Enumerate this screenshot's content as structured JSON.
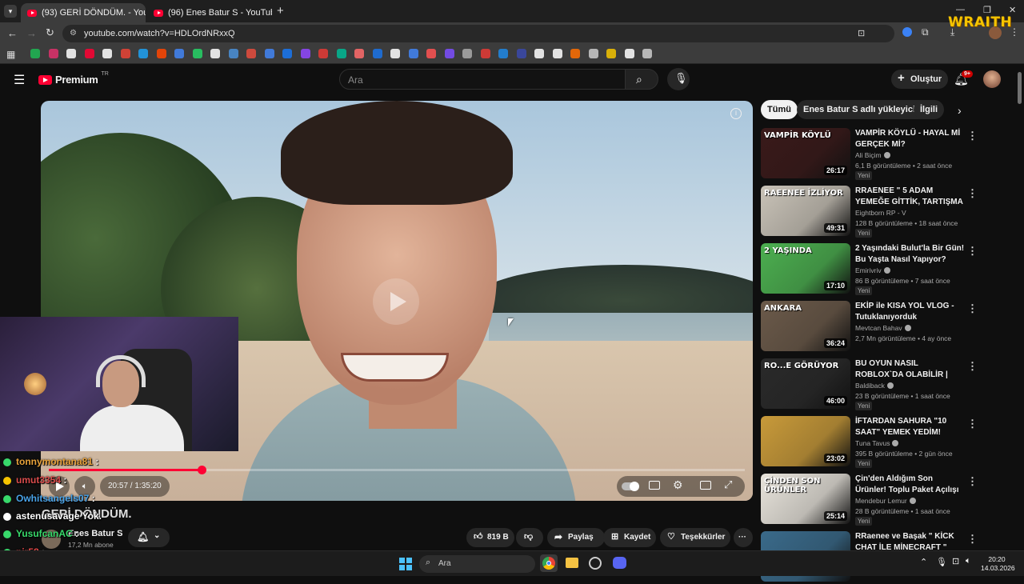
{
  "browser": {
    "tabs": [
      {
        "title": "(93) GERİ DÖNDÜM. - YouTube",
        "active": true
      },
      {
        "title": "(96) Enes Batur S - YouTube",
        "active": false
      }
    ],
    "url": "youtube.com/watch?v=HDLOrdNRxxQ",
    "overlay_logo": "WRAITH"
  },
  "youtube": {
    "logo": "Premium",
    "logo_sup": "TR",
    "search_placeholder": "Ara",
    "create_label": "Oluştur",
    "notif_badge": "9+",
    "accent": "#ff0033"
  },
  "player": {
    "time": "20:57 / 1:35:20",
    "progress": 0.22
  },
  "video": {
    "title_partial": "GERİ DÖNDÜM.",
    "channel": "Enes Batur S",
    "subscribers": "17,2 Mn abone",
    "likes": "819 B",
    "share": "Paylaş",
    "save": "Kaydet",
    "thanks": "Teşekkürler"
  },
  "filters": [
    "Tümü",
    "Enes Batur S adlı yükleyiciden",
    "İlgili"
  ],
  "related": [
    {
      "title": "VAMPİR KÖYLÜ - HAYAL Mİ GERÇEK Mİ?",
      "channel": "Ali Biçim",
      "verified": true,
      "meta": "6,1 B görüntüleme • 2 saat önce",
      "new": "Yeni",
      "duration": "26:17",
      "thumb_text": "VAMPİR KÖYLÜ",
      "thumb_color": "#3a1a1a"
    },
    {
      "title": "RRAENEE \" 5 ADAM YEMEĞE GİTTİK, TARTIŞMA ÇIKTI! \" ...",
      "channel": "Eightborn RP - V",
      "verified": false,
      "meta": "128 B görüntüleme • 18 saat önce",
      "new": "Yeni",
      "duration": "49:31",
      "thumb_text": "RAEENEE İZLİYOR",
      "thumb_color": "#c9c3b8"
    },
    {
      "title": "2 Yaşındaki Bulut'la Bir Gün! Bu Yaşta Nasıl Yapıyor?",
      "channel": "Emirivriv",
      "verified": true,
      "meta": "86 B görüntüleme • 7 saat önce",
      "new": "Yeni",
      "duration": "17:10",
      "thumb_text": "2 YAŞINDA",
      "thumb_color": "#4caf50"
    },
    {
      "title": "EKİP ile KISA YOL VLOG - Tutuklanıyorduk",
      "channel": "Mevtcan Bahav",
      "verified": true,
      "meta": "2,7 Mn görüntüleme • 4 ay önce",
      "new": "",
      "duration": "36:24",
      "thumb_text": "ANKARA",
      "thumb_color": "#6b5a4a"
    },
    {
      "title": "BU OYUN NASIL ROBLOX`DA OLABİLİR | Mulberry County",
      "channel": "Baldiback",
      "verified": true,
      "meta": "23 B görüntüleme • 1 saat önce",
      "new": "Yeni",
      "duration": "46:00",
      "thumb_text": "RO...E GÖRÜYOR",
      "thumb_color": "#2a2a2a"
    },
    {
      "title": "İFTARDAN SAHURA \"10 SAAT\" YEMEK YEDİM!",
      "channel": "Tuna Tavus",
      "verified": true,
      "meta": "395 B görüntüleme • 2 gün önce",
      "new": "Yeni",
      "duration": "23:02",
      "thumb_text": "",
      "thumb_color": "#c89a3a"
    },
    {
      "title": "Çin'den Aldığım Son Ürünler! Toplu Paket Açılışı",
      "channel": "Mendebur Lemur",
      "verified": true,
      "meta": "28 B görüntüleme • 1 saat önce",
      "new": "Yeni",
      "duration": "25:14",
      "thumb_text": "ÇİNDEN SON ÜRÜNLER",
      "thumb_color": "#e8e4dc"
    },
    {
      "title": "RRaenee ve Başak \" KİCK CHAT İLE MİNECRAFT \" Editimi İzliyor!",
      "channel": "",
      "verified": false,
      "meta": "",
      "new": "",
      "duration": "",
      "thumb_text": "",
      "thumb_color": "#3a6a8a"
    }
  ],
  "chat": [
    {
      "user": "tonnymontana81",
      "msg": ":",
      "color": "#e8a23a"
    },
    {
      "user": "umut3354",
      "msg": ":",
      "color": "#d94c4c"
    },
    {
      "user": "Owhitsangels07",
      "msg": ":",
      "color": "#4aa3e8"
    },
    {
      "user": "astenusavage",
      "msg": "Yok.",
      "color": "#ffffff"
    },
    {
      "user": "YusufcanAC",
      "msg": ":",
      "color": "#38d96b"
    },
    {
      "user": "pir58",
      "msg": ":",
      "color": "#e84a4a"
    },
    {
      "user": "larissam",
      "msg": ":",
      "color": "#ffffff"
    }
  ],
  "taskbar": {
    "search": "Ara",
    "time": "20:20",
    "date": "14.03.2026"
  }
}
